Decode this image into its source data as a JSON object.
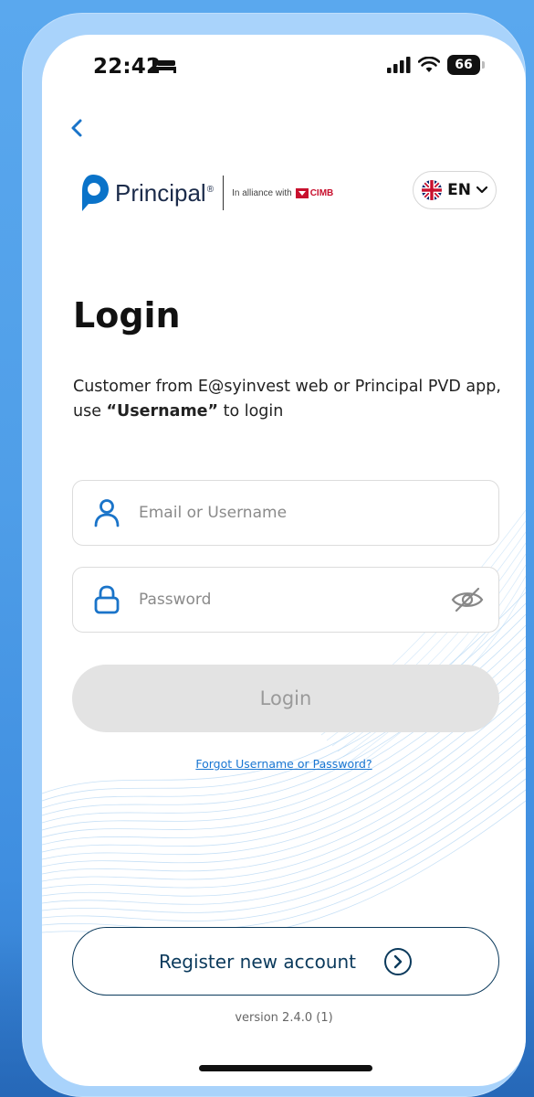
{
  "status_bar": {
    "time": "22:42",
    "battery": "66"
  },
  "brand": {
    "name": "Principal",
    "registered_mark": "®",
    "alliance_text": "In alliance with",
    "partner": "CIMB"
  },
  "language": {
    "label": "EN"
  },
  "login": {
    "title": "Login",
    "info_line1": "Customer from E@syinvest web or Principal PVD app,",
    "info_line2_prefix": "use ",
    "info_line2_bold": "“Username”",
    "info_line2_suffix": " to login",
    "username_placeholder": "Email or Username",
    "username_value": "",
    "password_placeholder": "Password",
    "password_value": "",
    "submit_label": "Login",
    "forgot_label": "Forgot Username or Password?"
  },
  "register": {
    "label": "Register new account"
  },
  "version": "version 2.4.0 (1)",
  "colors": {
    "accent_blue": "#1976d2",
    "icon_blue": "#1a74c9",
    "navy": "#0b3a5c",
    "disabled_bg": "#e3e3e3",
    "disabled_text": "#9a9a9a",
    "cimb_red": "#c8102e"
  },
  "icons": {
    "back": "chevron-left-icon",
    "status_sleep": "bed-icon",
    "signal": "signal-icon",
    "wifi": "wifi-icon",
    "flag": "uk-flag-icon",
    "lang_chevron": "chevron-down-icon",
    "user": "user-icon",
    "lock": "lock-icon",
    "eye": "eye-off-icon",
    "register_arrow": "chevron-right-circle-icon"
  }
}
